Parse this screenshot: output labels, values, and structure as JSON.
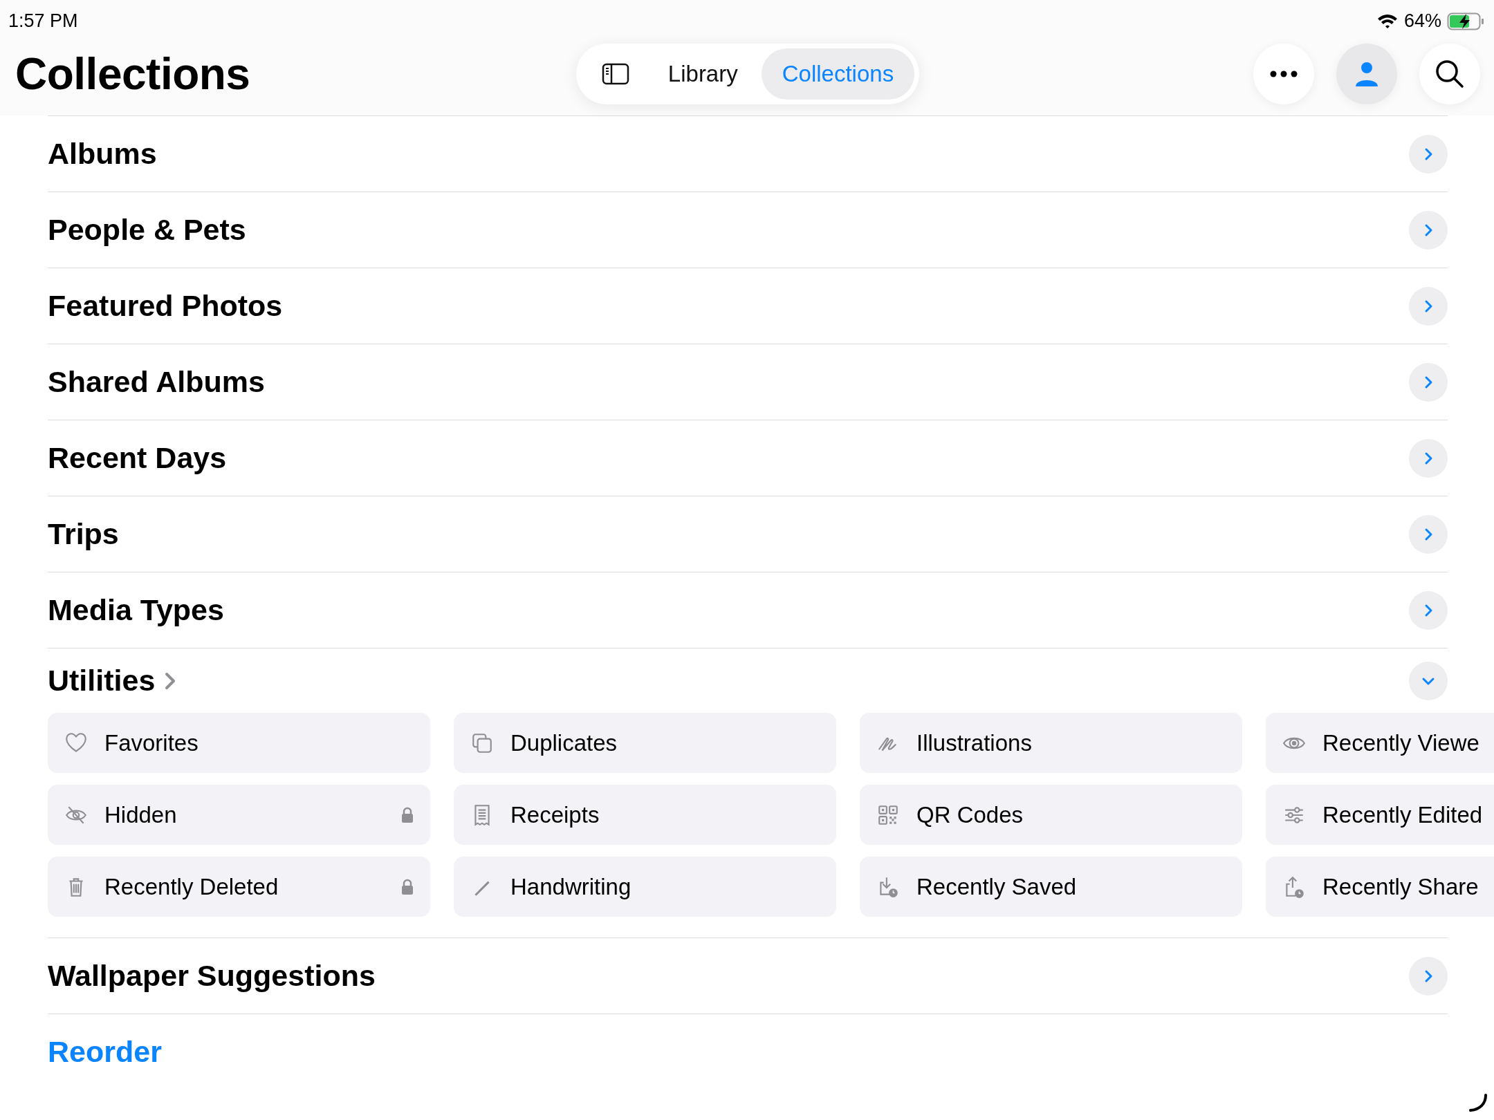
{
  "status_bar": {
    "time": "1:57 PM",
    "battery": "64%"
  },
  "title": "Collections",
  "tabs": [
    {
      "label": "Library",
      "selected": false
    },
    {
      "label": "Collections",
      "selected": true
    }
  ],
  "sections": [
    {
      "title": "Albums",
      "expanded": false
    },
    {
      "title": "People & Pets",
      "expanded": false
    },
    {
      "title": "Featured Photos",
      "expanded": false
    },
    {
      "title": "Shared Albums",
      "expanded": false
    },
    {
      "title": "Recent Days",
      "expanded": false
    },
    {
      "title": "Trips",
      "expanded": false
    },
    {
      "title": "Media Types",
      "expanded": false
    },
    {
      "title": "Utilities",
      "expanded": true,
      "items": [
        {
          "label": "Favorites",
          "locked": false
        },
        {
          "label": "Hidden",
          "locked": true
        },
        {
          "label": "Recently Deleted",
          "locked": true
        },
        {
          "label": "Duplicates",
          "locked": false
        },
        {
          "label": "Receipts",
          "locked": false
        },
        {
          "label": "Handwriting",
          "locked": false
        },
        {
          "label": "Illustrations",
          "locked": false
        },
        {
          "label": "QR Codes",
          "locked": false
        },
        {
          "label": "Recently Saved",
          "locked": false
        },
        {
          "label": "Recently Viewe",
          "locked": false
        },
        {
          "label": "Recently Edited",
          "locked": false
        },
        {
          "label": "Recently Share",
          "locked": false
        }
      ]
    },
    {
      "title": "Wallpaper Suggestions",
      "expanded": false
    }
  ],
  "reorder": "Reorder"
}
